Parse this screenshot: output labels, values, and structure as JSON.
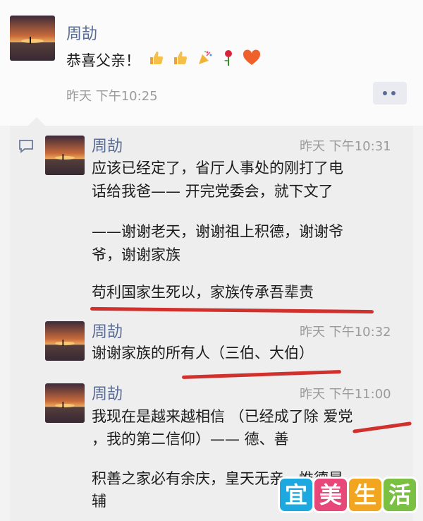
{
  "post": {
    "author": "周劼",
    "text": "恭喜父亲！",
    "emoji_icons": [
      "thumbs-up-icon",
      "thumbs-up-icon",
      "party-popper-icon",
      "rose-icon",
      "heart-icon"
    ],
    "time": "昨天 下午10:25"
  },
  "comments": [
    {
      "author": "周劼",
      "time": "昨天 下午10:31",
      "lines": [
        "应该已经定了，省厅人事处的刚打了电",
        "话给我爸—— 开完党委会，就下文了",
        "——谢谢老天，谢谢祖上积德，谢谢爷",
        "爷，谢谢家族",
        "苟利国家生死以，家族传承吾辈责"
      ]
    },
    {
      "author": "周劼",
      "time": "昨天 下午10:32",
      "lines": [
        "谢谢家族的所有人（三伯、大伯）"
      ]
    },
    {
      "author": "周劼",
      "time": "昨天 下午11:00",
      "lines": [
        "我现在是越来越相信 （已经成了除 爱党",
        "，我的第二信仰）—— 德、善",
        "积善之家必有余庆，皇天无亲，惟德是",
        "辅"
      ]
    }
  ],
  "watermark": {
    "chars": [
      "宜",
      "美",
      "生",
      "活"
    ],
    "colors": [
      "#1ea8e0",
      "#e8477a",
      "#f2a51f",
      "#7ac043"
    ]
  },
  "colors": {
    "name_link": "#576b95",
    "underline_annotation": "#d0312d"
  }
}
